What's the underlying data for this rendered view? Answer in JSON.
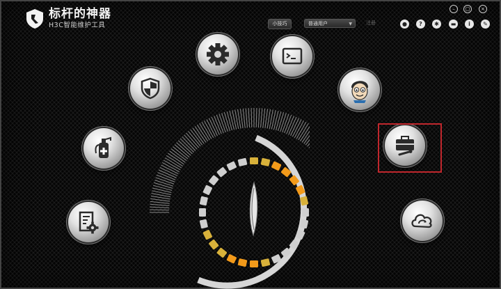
{
  "app": {
    "title": "标杆的神器",
    "subtitle": "H3C智能维护工具"
  },
  "toolbar": {
    "tips_label": "小技巧",
    "user_select_value": "普通用户",
    "login_label": "注册"
  },
  "window_controls": [
    "minimize-icon",
    "restore-icon",
    "close-icon"
  ],
  "top_icons": [
    "person-icon",
    "help-icon",
    "settings-icon",
    "message-icon",
    "info-icon",
    "feedback-icon"
  ],
  "features": [
    {
      "name": "settings-gear-feature",
      "icon": "gear-icon"
    },
    {
      "name": "command-console-feature",
      "icon": "terminal-icon"
    },
    {
      "name": "security-shield-feature",
      "icon": "shield-icon"
    },
    {
      "name": "network-engineer-feature",
      "icon": "engineer-avatar-icon"
    },
    {
      "name": "fire-extinguisher-feature",
      "icon": "fire-extinguisher-icon"
    },
    {
      "name": "toolbox-feature",
      "icon": "toolbox-icon",
      "highlighted": true
    },
    {
      "name": "config-document-feature",
      "icon": "document-gear-icon"
    },
    {
      "name": "cloud-sync-feature",
      "icon": "cloud-sync-icon"
    }
  ],
  "colors": {
    "highlight_border": "#c1272d",
    "segment_orange": "#f29a1a",
    "segment_yellow": "#d8b13a",
    "segment_gray": "#cfcfcf"
  }
}
